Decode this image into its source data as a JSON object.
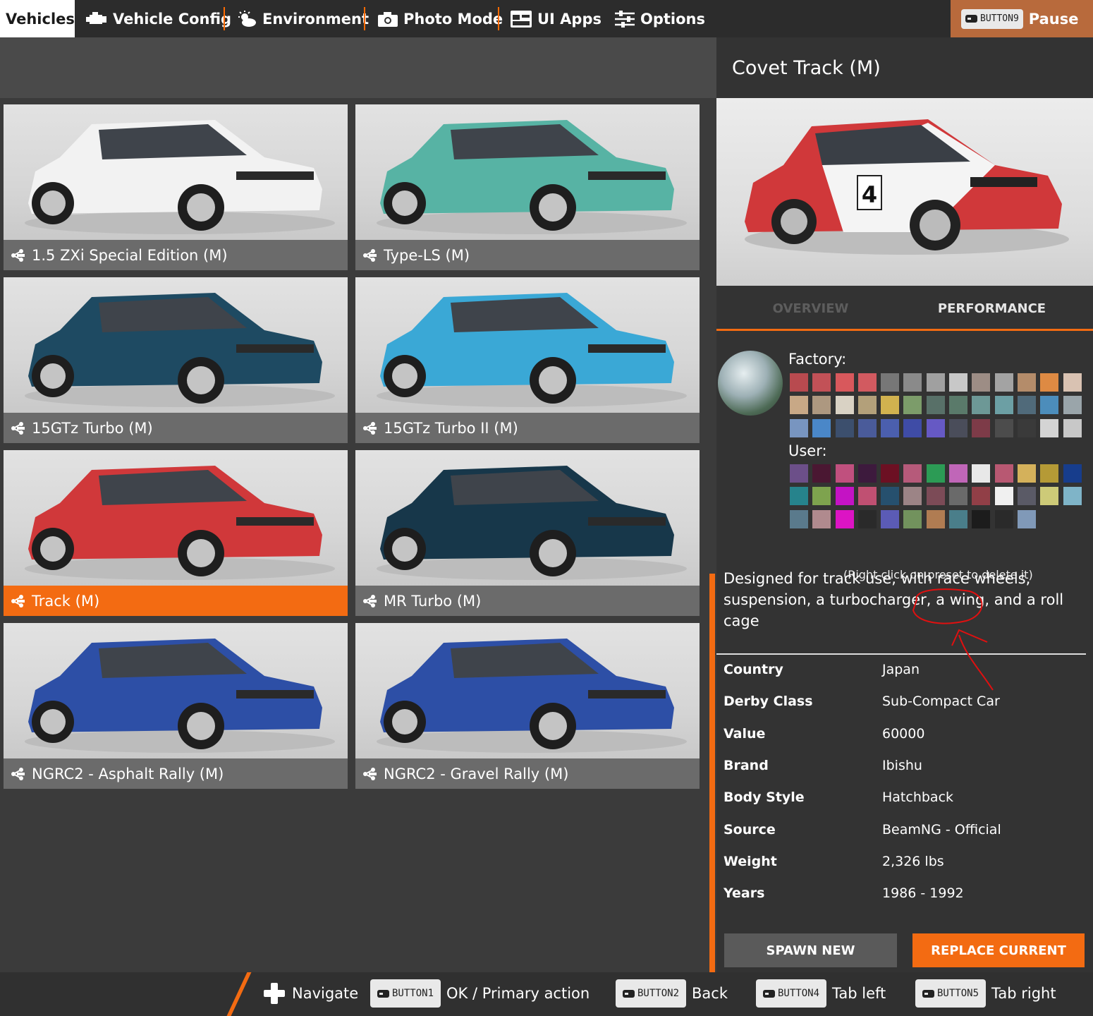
{
  "topnav": {
    "tabs": [
      {
        "label": "Vehicles",
        "icon": "none"
      },
      {
        "label": "Vehicle Config",
        "icon": "engine-icon"
      },
      {
        "label": "Environment",
        "icon": "weather-icon"
      },
      {
        "label": "Photo Mode",
        "icon": "camera-icon"
      },
      {
        "label": "UI Apps",
        "icon": "ui-apps-icon"
      },
      {
        "label": "Options",
        "icon": "sliders-icon"
      }
    ],
    "pause": {
      "button": "BUTTON9",
      "label": "Pause"
    }
  },
  "configs": [
    {
      "label": "1.5 ZXi Special Edition (M)",
      "color": "#f2f2f2",
      "selected": false
    },
    {
      "label": "Type-LS (M)",
      "color": "#57b3a4",
      "selected": false
    },
    {
      "label": "15GTz Turbo (M)",
      "color": "#1e4a62",
      "selected": false
    },
    {
      "label": "15GTz Turbo II (M)",
      "color": "#3aa8d6",
      "selected": false
    },
    {
      "label": "Track (M)",
      "color": "#d0383a",
      "selected": true
    },
    {
      "label": "MR Turbo (M)",
      "color": "#17374a",
      "selected": false
    },
    {
      "label": "NGRC2 - Asphalt Rally (M)",
      "color": "#2d4fa6",
      "selected": false
    },
    {
      "label": "NGRC2 - Gravel Rally (M)",
      "color": "#2d4fa6",
      "selected": false
    }
  ],
  "detail": {
    "title": "Covet Track (M)",
    "tabs": {
      "overview": "OVERVIEW",
      "performance": "PERFORMANCE"
    },
    "factory_label": "Factory:",
    "user_label": "User:",
    "note": "(Right click on preset to delete it)",
    "factory_colors": [
      "#b84a4f",
      "#c25157",
      "#d8585c",
      "#d25a60",
      "#777777",
      "#8a8a8a",
      "#a0a0a0",
      "#c8c8c8",
      "#9d8d85",
      "#a3a3a3",
      "#b48c6a",
      "#de8a43",
      "#d9c2b2",
      "#c8a886",
      "#ad9880",
      "#d9d2c4",
      "#b3a07a",
      "#d1b24f",
      "#7c9c6a",
      "#587068",
      "#5a7a6a",
      "#6d9896",
      "#6c9fa4",
      "#506a7a",
      "#4c8dbb",
      "#9aa5aa",
      "#7895c0",
      "#4a87c8",
      "#3c4f6d",
      "#4a5b9a",
      "#4b5fae",
      "#3f4ca6",
      "#6659c4",
      "#4a4d5a",
      "#7d3b48",
      "#4c4c4c",
      "#3a3a3a",
      "#d4d4d4",
      "#c8c8c8"
    ],
    "user_colors": [
      "#6c4f89",
      "#4a1732",
      "#c0507e",
      "#3d1a3d",
      "#6c1023",
      "#b65a7a",
      "#2c9b55",
      "#c066b8",
      "#e8e8e8",
      "#b85872",
      "#d4b15b",
      "#b59a36",
      "#173d8c",
      "#26838c",
      "#7ea34e",
      "#c413c4",
      "#c05072",
      "#26506e",
      "#9c8486",
      "#7c4b57",
      "#6a6a6a",
      "#913f47",
      "#f0f0f0",
      "#5a5a66",
      "#cdca78",
      "#7fb4c8",
      "#5a7a8c",
      "#b08a8e",
      "#dc14c4",
      "#2a2a2a",
      "#5b5bb6",
      "#72925d",
      "#b07c52",
      "#4a7e8a",
      "#1c1c1c",
      "#2a2a2a",
      "#8099b8"
    ],
    "description": "Designed for track use, with race wheels, suspension, a turbocharger, a wing, and a roll cage",
    "info": [
      {
        "key": "Country",
        "value": "Japan"
      },
      {
        "key": "Derby Class",
        "value": "Sub-Compact Car"
      },
      {
        "key": "Value",
        "value": "60000"
      },
      {
        "key": "Brand",
        "value": "Ibishu"
      },
      {
        "key": "Body Style",
        "value": "Hatchback"
      },
      {
        "key": "Source",
        "value": "BeamNG - Official"
      },
      {
        "key": "Weight",
        "value": "2,326 lbs"
      },
      {
        "key": "Years",
        "value": "1986 - 1992"
      }
    ],
    "buttons": {
      "spawn": "SPAWN NEW",
      "replace": "REPLACE CURRENT"
    }
  },
  "bottombar": {
    "navigate": "Navigate",
    "items": [
      {
        "button": "BUTTON1",
        "label": "OK / Primary action"
      },
      {
        "button": "BUTTON2",
        "label": "Back"
      },
      {
        "button": "BUTTON4",
        "label": "Tab left"
      },
      {
        "button": "BUTTON5",
        "label": "Tab right"
      }
    ]
  },
  "colors": {
    "accent": "#f36b12",
    "annotation": "#e01010"
  }
}
